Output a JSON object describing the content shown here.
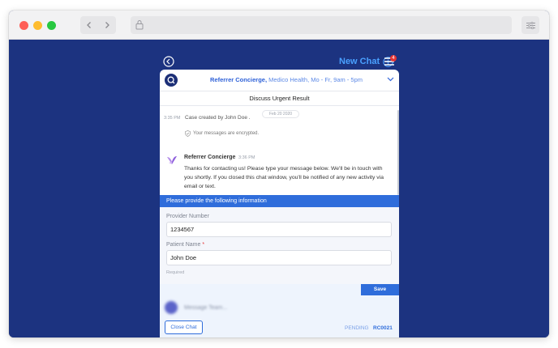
{
  "browser": {
    "back_icon": "chevron-left-icon",
    "forward_icon": "chevron-right-icon",
    "lock_icon": "lock-icon",
    "settings_icon": "sliders-icon"
  },
  "topbar": {
    "back_icon": "arrow-left-circle-icon",
    "new_chat_label": "New Chat",
    "new_chat_icon": "plus-circle-icon",
    "menu_icon": "menu-icon",
    "badge_count": "4"
  },
  "chat": {
    "header": {
      "name": "Referrer Concierge,",
      "details": "Medico Health, Mo - Fr, 9am - 5pm"
    },
    "subject": "Discuss Urgent Result",
    "log": {
      "time": "3:35 PM",
      "text": "Case created by John Doe .",
      "date": "Feb 20 2020"
    },
    "encrypted_note": "Your messages are encrypted.",
    "message": {
      "sender": "Referrer Concierge",
      "time": "3:36 PM",
      "text": "Thanks for contacting us! Please type your message below. We'll be in touch with you shortly. If you closed this chat window, you'll be notified of any new activity via email or text."
    },
    "form": {
      "banner": "Please provide the following information",
      "provider_label": "Provider Number",
      "provider_value": "1234567",
      "patient_label": "Patient Name",
      "patient_required_mark": "*",
      "patient_value": "John Doe",
      "required_note": "Required",
      "save_label": "Save"
    },
    "composer": {
      "placeholder": "Message Team..."
    },
    "footer": {
      "close_label": "Close Chat",
      "status": "PENDING",
      "case_id": "RC0021"
    }
  },
  "colors": {
    "background": "#1c3380",
    "accent": "#2f6ddb",
    "link": "#4aa0ff",
    "badge": "#e53535"
  }
}
